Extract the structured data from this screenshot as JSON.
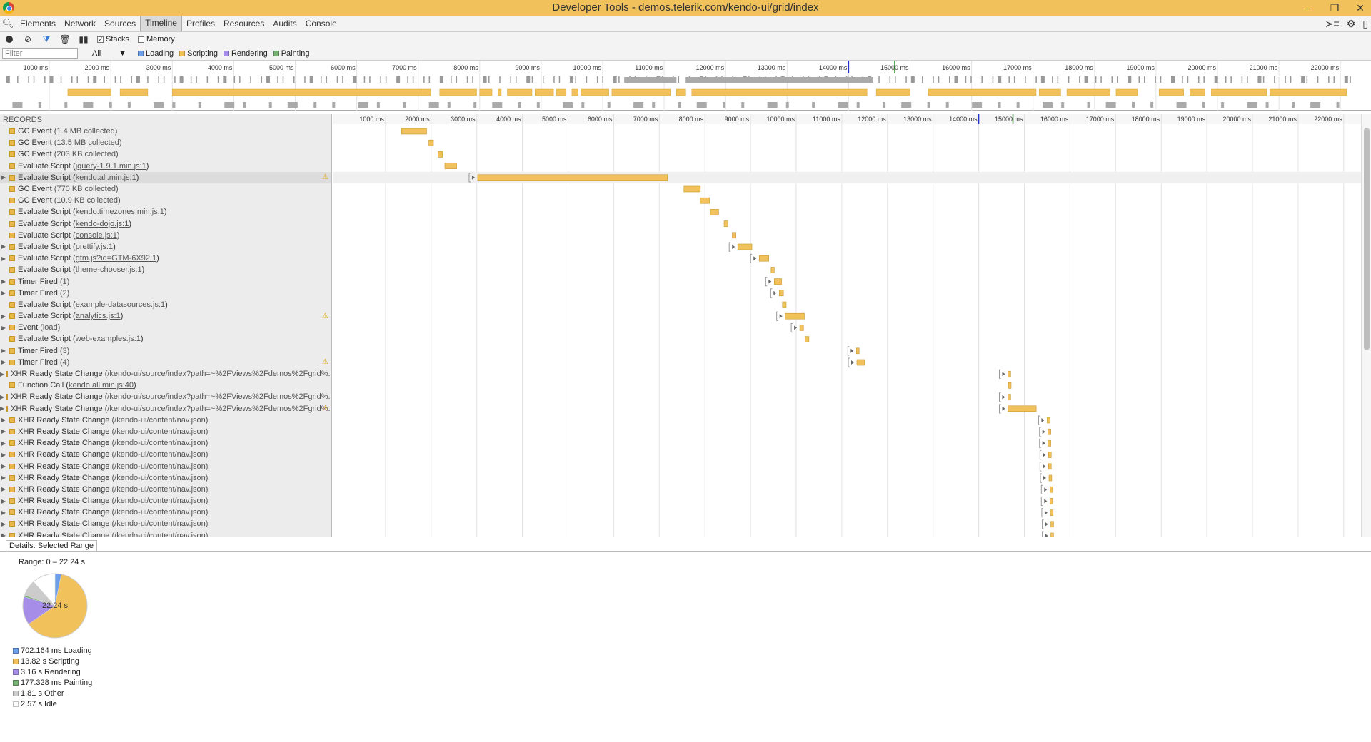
{
  "window": {
    "title": "Developer Tools - demos.telerik.com/kendo-ui/grid/index"
  },
  "tabs": [
    "Elements",
    "Network",
    "Sources",
    "Timeline",
    "Profiles",
    "Resources",
    "Audits",
    "Console"
  ],
  "active_tab": "Timeline",
  "toolbar": {
    "stacks_label": "Stacks",
    "memory_label": "Memory"
  },
  "filterbar": {
    "filter_placeholder": "Filter",
    "select_value": "All",
    "legend": [
      {
        "label": "Loading",
        "color": "#6d9eeb"
      },
      {
        "label": "Scripting",
        "color": "#f1c25c"
      },
      {
        "label": "Rendering",
        "color": "#a68ee8"
      },
      {
        "label": "Painting",
        "color": "#76b072"
      }
    ]
  },
  "overview_ticks": [
    "1000 ms",
    "2000 ms",
    "3000 ms",
    "4000 ms",
    "5000 ms",
    "6000 ms",
    "7000 ms",
    "8000 ms",
    "9000 ms",
    "10000 ms",
    "11000 ms",
    "12000 ms",
    "13000 ms",
    "14000 ms",
    "15000 ms",
    "16000 ms",
    "17000 ms",
    "18000 ms",
    "19000 ms",
    "20000 ms",
    "21000 ms",
    "22000 ms"
  ],
  "timeline_ticks": [
    "1000 ms",
    "2000 ms",
    "3000 ms",
    "4000 ms",
    "5000 ms",
    "6000 ms",
    "7000 ms",
    "8000 ms",
    "9000 ms",
    "10000 ms",
    "11000 ms",
    "12000 ms",
    "13000 ms",
    "14000 ms",
    "15000 ms",
    "16000 ms",
    "17000 ms",
    "18000 ms",
    "19000 ms",
    "20000 ms",
    "21000 ms",
    "22000 ms"
  ],
  "records_header": "RECORDS",
  "records": [
    {
      "name": "GC Event",
      "detail": "(1.4 MB collected)",
      "expand": false,
      "link": false
    },
    {
      "name": "GC Event",
      "detail": "(13.5 MB collected)",
      "expand": false,
      "link": false
    },
    {
      "name": "GC Event",
      "detail": "(203 KB collected)",
      "expand": false,
      "link": false
    },
    {
      "name": "Evaluate Script",
      "detail": "jquery-1.9.1.min.js:1",
      "expand": false,
      "link": true
    },
    {
      "name": "Evaluate Script",
      "detail": "kendo.all.min.js:1",
      "expand": true,
      "link": true,
      "warn": true,
      "selected": true
    },
    {
      "name": "GC Event",
      "detail": "(770 KB collected)",
      "expand": false,
      "link": false
    },
    {
      "name": "GC Event",
      "detail": "(10.9 KB collected)",
      "expand": false,
      "link": false
    },
    {
      "name": "Evaluate Script",
      "detail": "kendo.timezones.min.js:1",
      "expand": false,
      "link": true
    },
    {
      "name": "Evaluate Script",
      "detail": "kendo-dojo.js:1",
      "expand": false,
      "link": true
    },
    {
      "name": "Evaluate Script",
      "detail": "console.js:1",
      "expand": false,
      "link": true
    },
    {
      "name": "Evaluate Script",
      "detail": "prettify.js:1",
      "expand": true,
      "link": true
    },
    {
      "name": "Evaluate Script",
      "detail": "gtm.js?id=GTM-6X92:1",
      "expand": true,
      "link": true
    },
    {
      "name": "Evaluate Script",
      "detail": "theme-chooser.js:1",
      "expand": false,
      "link": true
    },
    {
      "name": "Timer Fired",
      "detail": "(1)",
      "expand": true,
      "link": false
    },
    {
      "name": "Timer Fired",
      "detail": "(2)",
      "expand": true,
      "link": false
    },
    {
      "name": "Evaluate Script",
      "detail": "example-datasources.js:1",
      "expand": false,
      "link": true
    },
    {
      "name": "Evaluate Script",
      "detail": "analytics.js:1",
      "expand": true,
      "link": true,
      "warn": true
    },
    {
      "name": "Event",
      "detail": "(load)",
      "expand": true,
      "link": false
    },
    {
      "name": "Evaluate Script",
      "detail": "web-examples.js:1",
      "expand": false,
      "link": true
    },
    {
      "name": "Timer Fired",
      "detail": "(3)",
      "expand": true,
      "link": false
    },
    {
      "name": "Timer Fired",
      "detail": "(4)",
      "expand": true,
      "link": false,
      "warn": true
    },
    {
      "name": "XHR Ready State Change",
      "detail": "(/kendo-ui/source/index?path=~%2FViews%2Fdemos%2Fgrid%...",
      "expand": true,
      "link": false
    },
    {
      "name": "Function Call",
      "detail": "kendo.all.min.js:40",
      "expand": false,
      "link": true
    },
    {
      "name": "XHR Ready State Change",
      "detail": "(/kendo-ui/source/index?path=~%2FViews%2Fdemos%2Fgrid%...",
      "expand": true,
      "link": false
    },
    {
      "name": "XHR Ready State Change",
      "detail": "(/kendo-ui/source/index?path=~%2FViews%2Fdemos%2Fgrid%...",
      "expand": true,
      "link": false,
      "warn": true
    },
    {
      "name": "XHR Ready State Change",
      "detail": "(/kendo-ui/content/nav.json)",
      "expand": true,
      "link": false
    },
    {
      "name": "XHR Ready State Change",
      "detail": "(/kendo-ui/content/nav.json)",
      "expand": true,
      "link": false
    },
    {
      "name": "XHR Ready State Change",
      "detail": "(/kendo-ui/content/nav.json)",
      "expand": true,
      "link": false
    },
    {
      "name": "XHR Ready State Change",
      "detail": "(/kendo-ui/content/nav.json)",
      "expand": true,
      "link": false
    },
    {
      "name": "XHR Ready State Change",
      "detail": "(/kendo-ui/content/nav.json)",
      "expand": true,
      "link": false
    },
    {
      "name": "XHR Ready State Change",
      "detail": "(/kendo-ui/content/nav.json)",
      "expand": true,
      "link": false
    },
    {
      "name": "XHR Ready State Change",
      "detail": "(/kendo-ui/content/nav.json)",
      "expand": true,
      "link": false
    },
    {
      "name": "XHR Ready State Change",
      "detail": "(/kendo-ui/content/nav.json)",
      "expand": true,
      "link": false
    },
    {
      "name": "XHR Ready State Change",
      "detail": "(/kendo-ui/content/nav.json)",
      "expand": true,
      "link": false
    },
    {
      "name": "XHR Ready State Change",
      "detail": "(/kendo-ui/content/nav.json)",
      "expand": true,
      "link": false
    },
    {
      "name": "XHR Ready State Change",
      "detail": "(/kendo-ui/content/nav.json)",
      "expand": true,
      "link": false
    }
  ],
  "record_bars": [
    {
      "start": 1350,
      "end": 1900
    },
    {
      "start": 1950,
      "end": 2050
    },
    {
      "start": 2150,
      "end": 2250
    },
    {
      "start": 2300,
      "end": 2560
    },
    {
      "start": 3020,
      "end": 7180
    },
    {
      "start": 7540,
      "end": 7900
    },
    {
      "start": 7900,
      "end": 8100
    },
    {
      "start": 8120,
      "end": 8300
    },
    {
      "start": 8420,
      "end": 8500
    },
    {
      "start": 8600,
      "end": 8680
    },
    {
      "start": 8720,
      "end": 9030
    },
    {
      "start": 9190,
      "end": 9400
    },
    {
      "start": 9450,
      "end": 9520
    },
    {
      "start": 9520,
      "end": 9680
    },
    {
      "start": 9630,
      "end": 9720
    },
    {
      "start": 9700,
      "end": 9780
    },
    {
      "start": 9760,
      "end": 10180
    },
    {
      "start": 10080,
      "end": 10160
    },
    {
      "start": 10200,
      "end": 10280
    },
    {
      "start": 11320,
      "end": 11380
    },
    {
      "start": 11330,
      "end": 11500
    },
    {
      "start": 14640,
      "end": 14700
    },
    {
      "start": 14650,
      "end": 14710
    },
    {
      "start": 14640,
      "end": 14700
    },
    {
      "start": 14640,
      "end": 15260
    },
    {
      "start": 15500,
      "end": 15560
    },
    {
      "start": 15520,
      "end": 15580
    },
    {
      "start": 15520,
      "end": 15580
    },
    {
      "start": 15530,
      "end": 15590
    },
    {
      "start": 15530,
      "end": 15590
    },
    {
      "start": 15540,
      "end": 15600
    },
    {
      "start": 15560,
      "end": 15620
    },
    {
      "start": 15560,
      "end": 15620
    },
    {
      "start": 15570,
      "end": 15630
    },
    {
      "start": 15580,
      "end": 15640
    },
    {
      "start": 15580,
      "end": 15640
    }
  ],
  "overview_scripting_segments": [
    [
      1300,
      2000
    ],
    [
      2150,
      2600
    ],
    [
      3000,
      7200
    ],
    [
      7350,
      7950
    ],
    [
      8000,
      8200
    ],
    [
      8300,
      8350
    ],
    [
      8450,
      8850
    ],
    [
      8900,
      9200
    ],
    [
      9250,
      9400
    ],
    [
      9500,
      9600
    ],
    [
      9650,
      10100
    ],
    [
      10150,
      11100
    ],
    [
      11200,
      11350
    ],
    [
      11450,
      14300
    ],
    [
      14450,
      15000
    ],
    [
      15300,
      17050
    ],
    [
      17100,
      17450
    ],
    [
      17550,
      18250
    ],
    [
      18350,
      18700
    ],
    [
      19050,
      19450
    ],
    [
      19550,
      19800
    ],
    [
      19900,
      20800
    ],
    [
      20850,
      22100
    ]
  ],
  "markers": {
    "blue_ms": 14000,
    "green_ms": 14750
  },
  "details": {
    "tab_label": "Details: Selected Range",
    "range": "Range: 0 – 22.24 s",
    "pie_center": "22.24 s",
    "breakdown": [
      {
        "label": "702.164 ms Loading",
        "ms": 702.164,
        "color": "#6d9eeb"
      },
      {
        "label": "13.82 s Scripting",
        "ms": 13820,
        "color": "#f1c25c"
      },
      {
        "label": "3.16 s Rendering",
        "ms": 3160,
        "color": "#a68ee8"
      },
      {
        "label": "177.328 ms Painting",
        "ms": 177.328,
        "color": "#76b072"
      },
      {
        "label": "1.81 s Other",
        "ms": 1810,
        "color": "#cccccc"
      },
      {
        "label": "2.57 s Idle",
        "ms": 2570,
        "color": "#ffffff"
      }
    ]
  }
}
